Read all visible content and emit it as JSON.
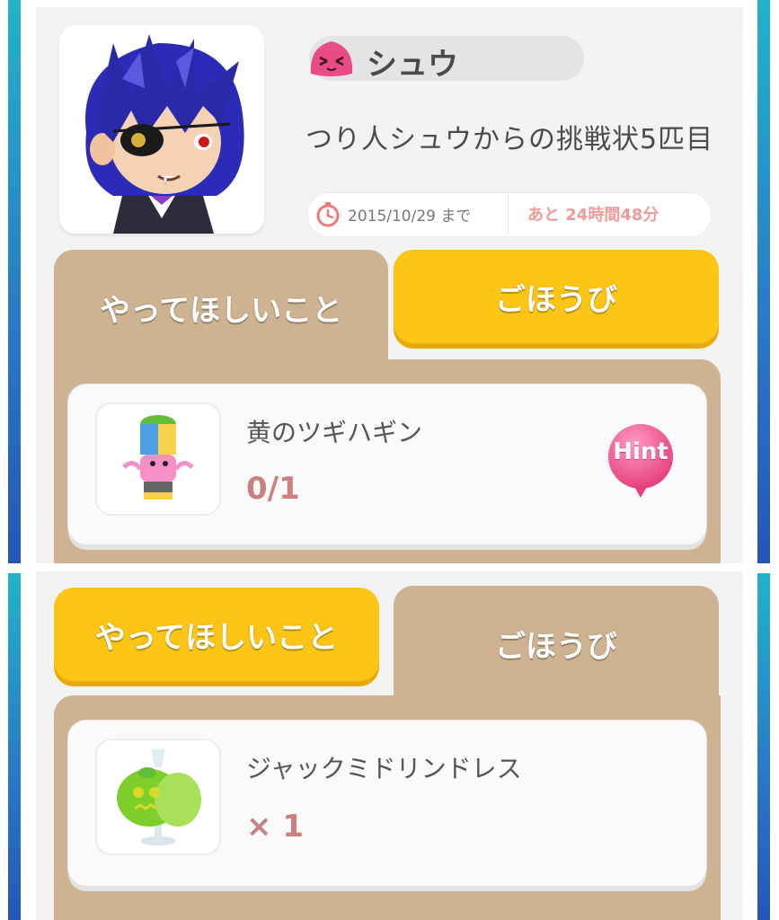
{
  "profile": {
    "name": "シュウ",
    "challenge_title": "つり人シュウからの挑戦状5匹目",
    "deadline": "2015/10/29 まで",
    "remaining": "あと 24時間48分"
  },
  "tabs": {
    "request": "やってほしいこと",
    "reward": "ごほうび"
  },
  "request_item": {
    "name": "黄のツギハギン",
    "progress": "0/1",
    "hint_label": "Hint"
  },
  "reward_item": {
    "name": "ジャックミドリンドレス",
    "quantity": "× 1"
  },
  "colors": {
    "tab_active": "#fdc516",
    "tab_inactive": "#cdb391",
    "accent_pink": "#e84b86",
    "count_text": "#c98080"
  }
}
